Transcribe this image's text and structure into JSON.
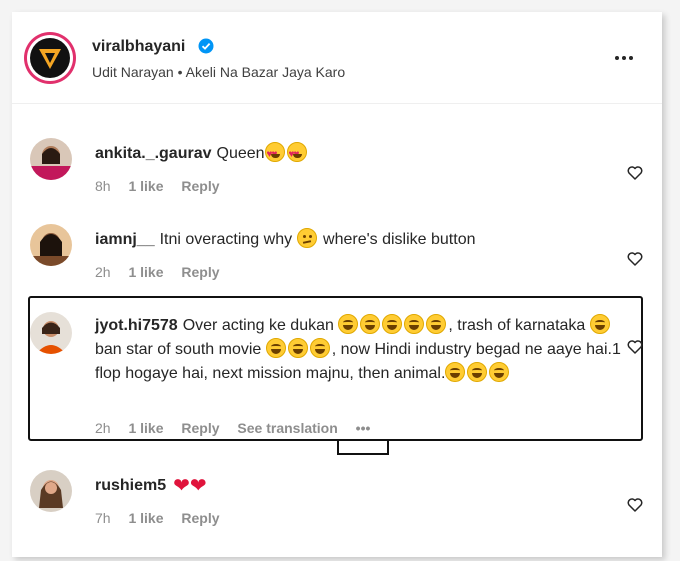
{
  "post": {
    "username": "viralbhayani",
    "audio": "Udit Narayan • Akeli Na Bazar Jaya Karo"
  },
  "comments": [
    {
      "username": "ankita._.gaurav",
      "text": "Queen",
      "emojis": [
        "heart-eyes-emoji",
        "heart-eyes-emoji"
      ],
      "time": "8h",
      "likes": "1 like",
      "reply": "Reply"
    },
    {
      "username": "iamnj__",
      "text_before": "Itni overacting why",
      "text_after": "where's dislike button",
      "emoji": "confused-emoji",
      "time": "2h",
      "likes": "1 like",
      "reply": "Reply"
    },
    {
      "username": "jyot.hi7578",
      "seg1": "Over acting ke dukan",
      "seg2": ", trash of karnataka",
      "seg3": "ban star of south movie",
      "seg4": ", now Hindi industry begad ne aaye hai.1 flop hogaye hai, next mission majnu, then animal.",
      "time": "2h",
      "likes": "1 like",
      "reply": "Reply",
      "translate": "See translation",
      "more": "•••"
    },
    {
      "username": "rushiem5",
      "hearts": "❤❤",
      "time": "7h",
      "likes": "1 like",
      "reply": "Reply"
    }
  ],
  "icons": {
    "verified": "verified-badge-icon",
    "more": "more-options-icon",
    "like": "heart-outline-icon"
  },
  "colors": {
    "verified": "#0095f6",
    "muted": "#8e8e8e",
    "heart": "#e0143c"
  }
}
